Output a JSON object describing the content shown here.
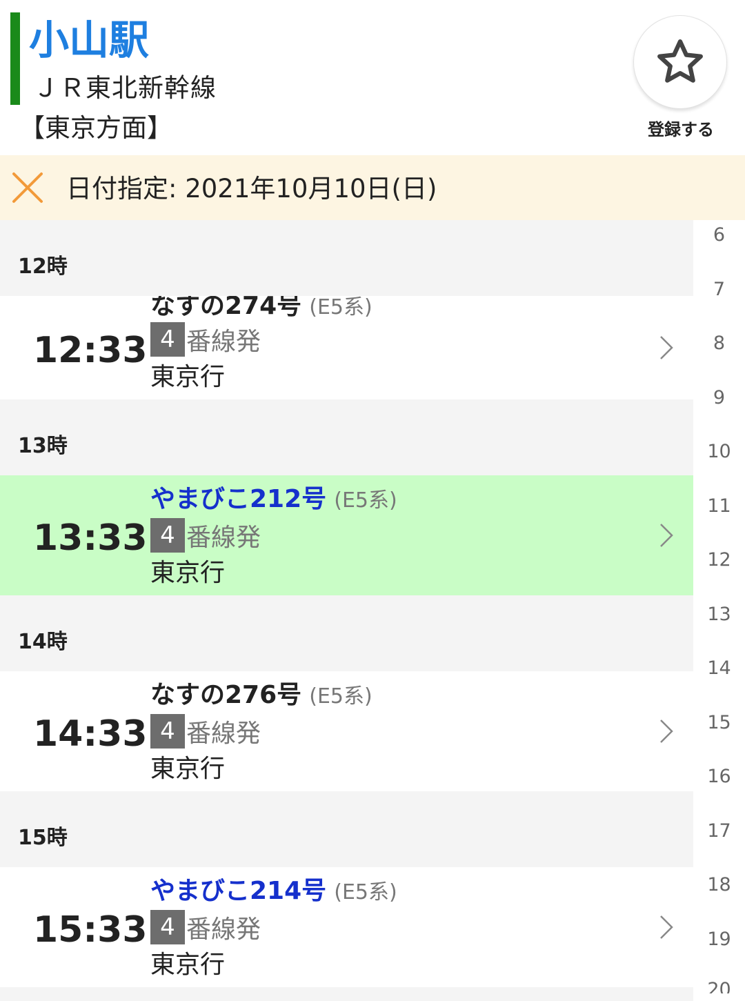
{
  "header": {
    "station_name": "小山駅",
    "line_name": "ＪＲ東北新幹線",
    "direction": "【東京方面】",
    "favorite_label": "登録する",
    "line_color": "#1a8a1a"
  },
  "date_bar": {
    "text": "日付指定: 2021年10月10日(日)",
    "close_icon": "close-x-icon"
  },
  "timetable": [
    {
      "hour_label": "12時",
      "train": {
        "time": "12:33",
        "name": "なすの274号",
        "type": "(E5系)",
        "platform": "4",
        "platform_suffix": "番線発",
        "destination": "東京行",
        "name_color": "black",
        "highlighted": false
      }
    },
    {
      "hour_label": "13時",
      "train": {
        "time": "13:33",
        "name": "やまびこ212号",
        "type": "(E5系)",
        "platform": "4",
        "platform_suffix": "番線発",
        "destination": "東京行",
        "name_color": "blue",
        "highlighted": true
      }
    },
    {
      "hour_label": "14時",
      "train": {
        "time": "14:33",
        "name": "なすの276号",
        "type": "(E5系)",
        "platform": "4",
        "platform_suffix": "番線発",
        "destination": "東京行",
        "name_color": "black",
        "highlighted": false
      }
    },
    {
      "hour_label": "15時",
      "train": {
        "time": "15:33",
        "name": "やまびこ214号",
        "type": "(E5系)",
        "platform": "4",
        "platform_suffix": "番線発",
        "destination": "東京行",
        "name_color": "blue",
        "highlighted": false
      }
    }
  ],
  "hour_index": [
    "6",
    "7",
    "8",
    "9",
    "10",
    "11",
    "12",
    "13",
    "14",
    "15",
    "16",
    "17",
    "18",
    "19",
    "20"
  ],
  "colors": {
    "station_name": "#1e7fe0",
    "highlight_row": "#c9fdc6",
    "date_bar_bg": "#fdf5e2",
    "close_icon": "#f29a3a",
    "train_name_blue": "#1530cc"
  }
}
